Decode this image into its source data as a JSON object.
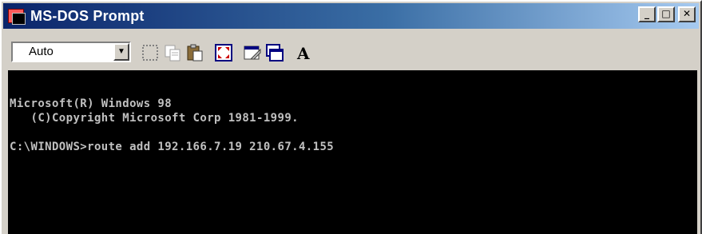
{
  "window": {
    "title": "MS-DOS Prompt",
    "controls": {
      "minimize_icon": "minimize-icon",
      "maximize_icon": "maximize-icon",
      "close_icon": "close-icon"
    }
  },
  "toolbar": {
    "font_size_value": "Auto",
    "tools": [
      {
        "name": "mark-icon"
      },
      {
        "name": "copy-icon"
      },
      {
        "name": "paste-icon"
      },
      {
        "name": "full-screen-icon"
      },
      {
        "name": "properties-icon"
      },
      {
        "name": "background-icon"
      },
      {
        "name": "font-icon"
      }
    ]
  },
  "console": {
    "lines": [
      "Microsoft(R) Windows 98",
      "   (C)Copyright Microsoft Corp 1981-1999.",
      "C:\\WINDOWS>route add 192.166.7.19 210.67.4.155"
    ]
  },
  "colors": {
    "title_bar_start": "#0a246a",
    "title_bar_end": "#a6caf0",
    "console_background": "#000000",
    "console_text": "#c0c0c0",
    "chrome": "#d4d0c8"
  }
}
